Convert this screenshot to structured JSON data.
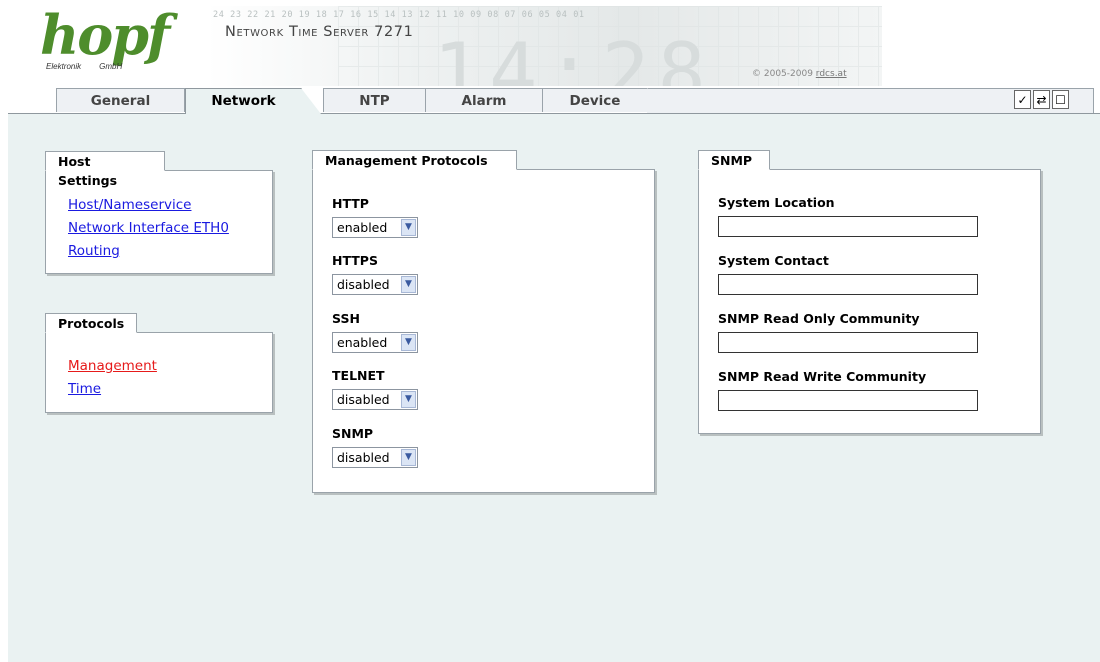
{
  "header": {
    "logo_word": "hopf",
    "logo_sub_left": "Elektronik",
    "logo_sub_right": "GmbH",
    "numbers": "24 23 22 21 20 19 18 17 16 15 14 13 12 11 10 09 08 07 06 05 04 01",
    "title": "Network Time Server 7271",
    "copyright": "© 2005-2009",
    "copyright_link": "rdcs.at"
  },
  "tabs": [
    {
      "label": "General"
    },
    {
      "label": "Network",
      "active": true
    },
    {
      "label": "NTP"
    },
    {
      "label": "Alarm"
    },
    {
      "label": "Device"
    }
  ],
  "toolbar": {
    "apply_icon": "check-icon",
    "reload_icon": "reload-icon",
    "save_icon": "save-icon",
    "apply": "✓",
    "reload": "⇄",
    "save": "☐"
  },
  "host_settings": {
    "title": "Host Settings",
    "links": [
      "Host/Nameservice",
      "Network Interface ETH0",
      "Routing"
    ]
  },
  "protocols": {
    "title": "Protocols",
    "links": [
      "Management",
      "Time"
    ],
    "active": "Management"
  },
  "management": {
    "title": "Management Protocols",
    "items": [
      {
        "label": "HTTP",
        "value": "enabled"
      },
      {
        "label": "HTTPS",
        "value": "disabled"
      },
      {
        "label": "SSH",
        "value": "enabled"
      },
      {
        "label": "TELNET",
        "value": "disabled"
      },
      {
        "label": "SNMP",
        "value": "disabled"
      }
    ]
  },
  "snmp": {
    "title": "SNMP",
    "fields": [
      {
        "label": "System Location",
        "value": ""
      },
      {
        "label": "System Contact",
        "value": ""
      },
      {
        "label": "SNMP Read Only Community",
        "value": ""
      },
      {
        "label": "SNMP Read Write Community",
        "value": ""
      }
    ]
  },
  "colors": {
    "accent": "#4e8d2c",
    "link": "#1a1ae0",
    "active_link": "#e61a1a",
    "background": "#eaf2f2"
  }
}
